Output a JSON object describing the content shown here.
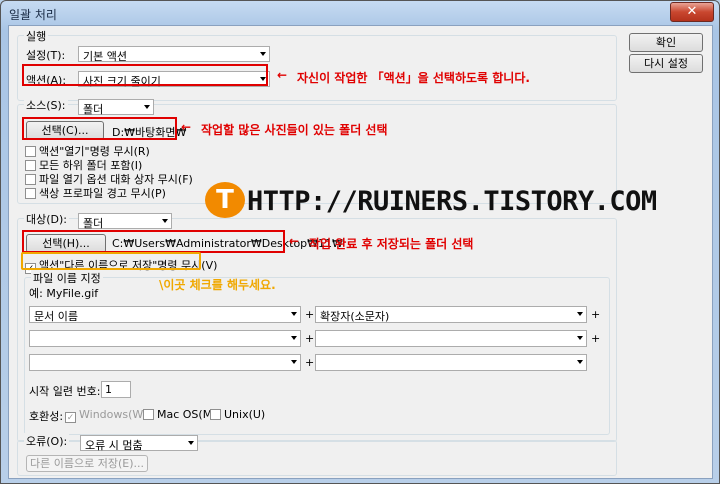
{
  "window": {
    "title": "일괄 처리",
    "close_glyph": "✕"
  },
  "right_buttons": {
    "ok": "확인",
    "reset": "다시 설정"
  },
  "run": {
    "group_label": "실행",
    "set_label": "설정(T):",
    "set_value": "기본 액션",
    "action_label": "액션(A):",
    "action_value": "사진 크기 줄이기"
  },
  "source": {
    "group_label": "소스(S):",
    "source_value": "폴더",
    "choose_button": "선택(C)...",
    "path": "D:₩바탕화면₩",
    "checkboxes": [
      {
        "label": "액션\"열기\"명령 무시(R)",
        "checked": false
      },
      {
        "label": "모든 하위 폴더 포함(I)",
        "checked": false
      },
      {
        "label": "파일 열기 옵션 대화 상자 무시(F)",
        "checked": false
      },
      {
        "label": "색상 프로파일 경고 무시(P)",
        "checked": false
      }
    ]
  },
  "destination": {
    "group_label": "대상(D):",
    "dest_value": "폴더",
    "choose_button": "선택(H)...",
    "path": "C:₩Users₩Administrator₩Desktop₩11₩",
    "override_checkbox": {
      "label": "액션\"다른 이름으로 저장\"명령 무시(V)",
      "checked": true,
      "mark": "✓"
    }
  },
  "file_naming": {
    "group_label": "파일 이름 지정",
    "example": "예: MyFile.gif",
    "rows": [
      {
        "left": "문서 이름",
        "right": "확장자(소문자)"
      },
      {
        "left": "",
        "right": ""
      },
      {
        "left": "",
        "right": ""
      }
    ],
    "plus": "+",
    "serial_label": "시작 일련 번호:",
    "serial_value": "1",
    "compat_label": "호환성:",
    "compat": [
      {
        "label": "Windows(W)",
        "checked": true,
        "disabled": true
      },
      {
        "label": "Mac OS(M)",
        "checked": false,
        "disabled": false
      },
      {
        "label": "Unix(U)",
        "checked": false,
        "disabled": false
      }
    ]
  },
  "errors": {
    "group_label": "오류(O):",
    "value": "오류 시 멈춤",
    "save_as_button": "다른 이름으로 저장(E)..."
  },
  "annotations": {
    "note_action": "자신이 작업한 「액션」을 선택하도록 합니다.",
    "note_source": "작업할 많은 사진들이 있는 폴더 선택",
    "note_dest": "작업 완료 후 저장되는 폴더 선택",
    "note_check": "\\이곳 체크를 해두세요.",
    "arrow_glyph": "←",
    "logo_letter": "T",
    "watermark": "HTTP://RUINERS.TISTORY.COM"
  },
  "colors": {
    "annotation_red": "#e00000",
    "annotation_orange": "#f0a800",
    "logo_orange": "#f28a00"
  }
}
